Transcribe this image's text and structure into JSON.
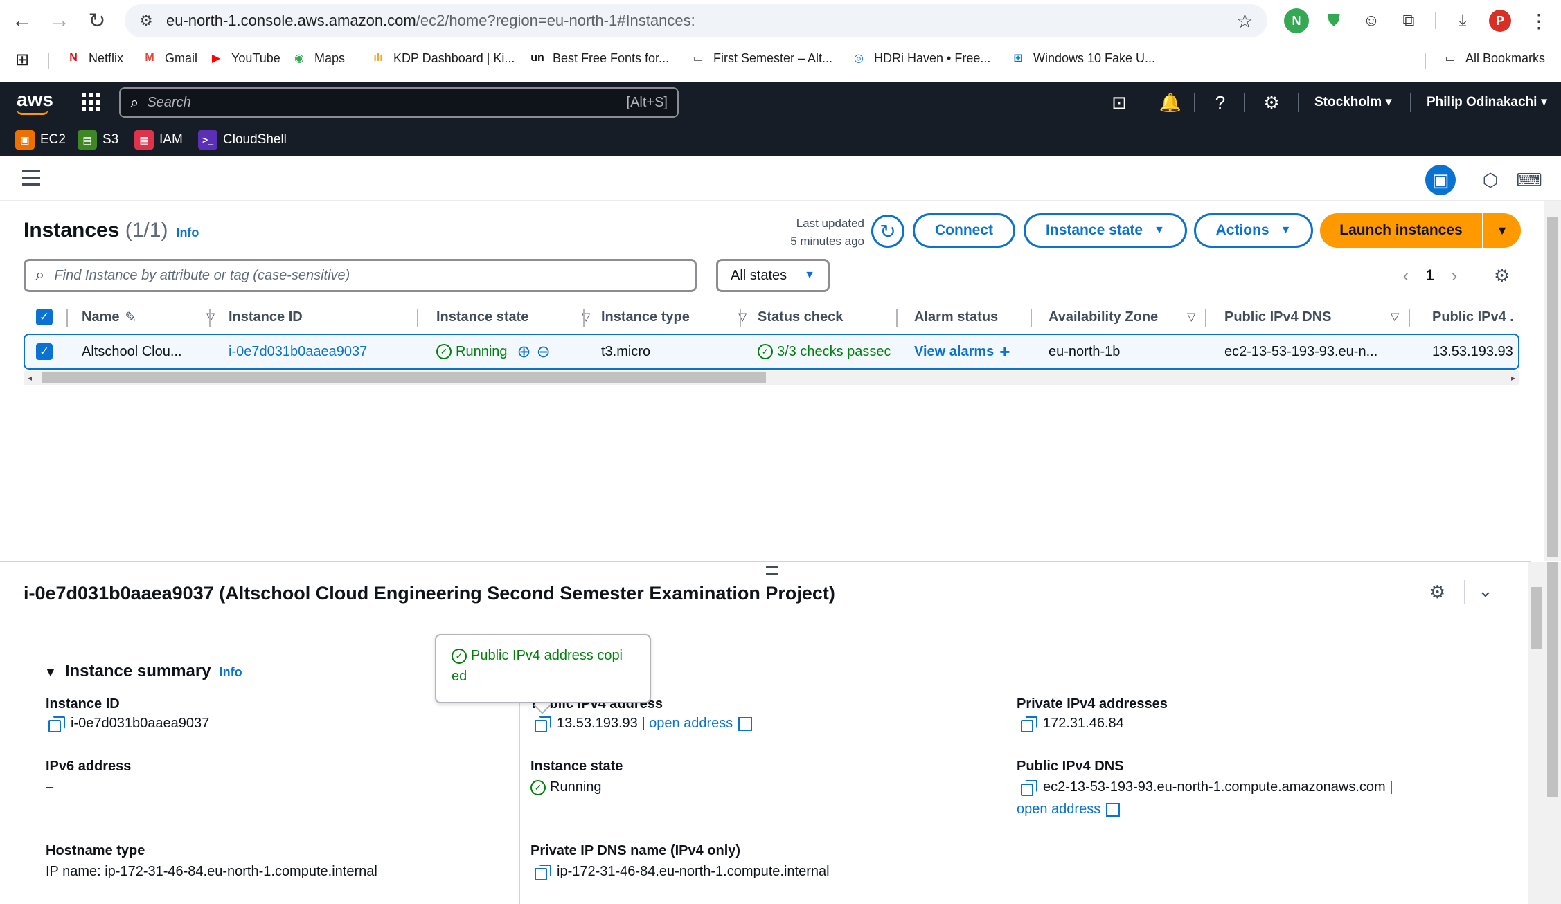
{
  "browser": {
    "url_host": "eu-north-1.console.aws.amazon.com",
    "url_path": "/ec2/home?region=eu-north-1#Instances:",
    "bookmarks": [
      {
        "label": "Netflix",
        "icon": "N",
        "color": "#e50914"
      },
      {
        "label": "Gmail",
        "icon": "M",
        "color": "#ea4335"
      },
      {
        "label": "YouTube",
        "icon": "▶",
        "color": "#ff0000"
      },
      {
        "label": "Maps",
        "icon": "◉",
        "color": "#34a853"
      },
      {
        "label": "KDP Dashboard | Ki...",
        "icon": "ılı",
        "color": "#f5a623"
      },
      {
        "label": "Best Free Fonts for...",
        "icon": "un",
        "color": "#111111"
      },
      {
        "label": "First Semester – Alt...",
        "icon": "▭",
        "color": "#5f6368"
      },
      {
        "label": "HDRi Haven • Free...",
        "icon": "◎",
        "color": "#1a73e8"
      },
      {
        "label": "Windows 10 Fake U...",
        "icon": "⊞",
        "color": "#0078d7"
      }
    ],
    "all_bookmarks": "All Bookmarks",
    "profile_initial": "P"
  },
  "aws": {
    "logo": "aws",
    "search_placeholder": "Search",
    "search_shortcut": "[Alt+S]",
    "region": "Stockholm",
    "user": "Philip Odinakachi",
    "favorites": [
      {
        "label": "EC2",
        "color": "#ed7100",
        "icon": "▣"
      },
      {
        "label": "S3",
        "color": "#3f8624",
        "icon": "▤"
      },
      {
        "label": "IAM",
        "color": "#dd344c",
        "icon": "▦"
      },
      {
        "label": "CloudShell",
        "color": "#5a30b5",
        "icon": ">_"
      }
    ]
  },
  "instances": {
    "title": "Instances",
    "count": "(1/1)",
    "info": "Info",
    "last_updated_1": "Last updated",
    "last_updated_2": "5 minutes ago",
    "connect": "Connect",
    "instance_state": "Instance state",
    "actions": "Actions",
    "launch": "Launch instances",
    "find_placeholder": "Find Instance by attribute or tag (case-sensitive)",
    "all_states": "All states",
    "page": "1",
    "columns": {
      "name": "Name",
      "instance_id": "Instance ID",
      "instance_state": "Instance state",
      "instance_type": "Instance type",
      "status_check": "Status check",
      "alarm_status": "Alarm status",
      "az": "Availability Zone",
      "public_dns": "Public IPv4 DNS",
      "public_ip": "Public IPv4 ."
    },
    "row": {
      "name": "Altschool Clou...",
      "instance_id": "i-0e7d031b0aaea9037",
      "state": "Running",
      "type": "t3.micro",
      "status": "3/3 checks passec",
      "alarm": "View alarms",
      "az": "eu-north-1b",
      "public_dns": "ec2-13-53-193-93.eu-n...",
      "public_ip": "13.53.193.93"
    }
  },
  "detail": {
    "title": "i-0e7d031b0aaea9037 (Altschool Cloud Engineering Second Semester Examination Project)",
    "summary": "Instance summary",
    "info": "Info",
    "instance_id_label": "Instance ID",
    "instance_id": "i-0e7d031b0aaea9037",
    "ipv6_label": "IPv6 address",
    "ipv6": "–",
    "hostname_type_label": "Hostname type",
    "hostname_type": "IP name: ip-172-31-46-84.eu-north-1.compute.internal",
    "public_ipv4_label": "Public IPv4 address",
    "public_ipv4": "13.53.193.93",
    "open_address": "open address",
    "state_label": "Instance state",
    "state": "Running",
    "private_dns_label": "Private IP DNS name (IPv4 only)",
    "private_dns": "ip-172-31-46-84.eu-north-1.compute.internal",
    "private_ipv4_label": "Private IPv4 addresses",
    "private_ipv4": "172.31.46.84",
    "public_dns_label": "Public IPv4 DNS",
    "public_dns": "ec2-13-53-193-93.eu-north-1.compute.amazonaws.com",
    "toast_1": "Public IPv4 address copi",
    "toast_2": "ed"
  }
}
